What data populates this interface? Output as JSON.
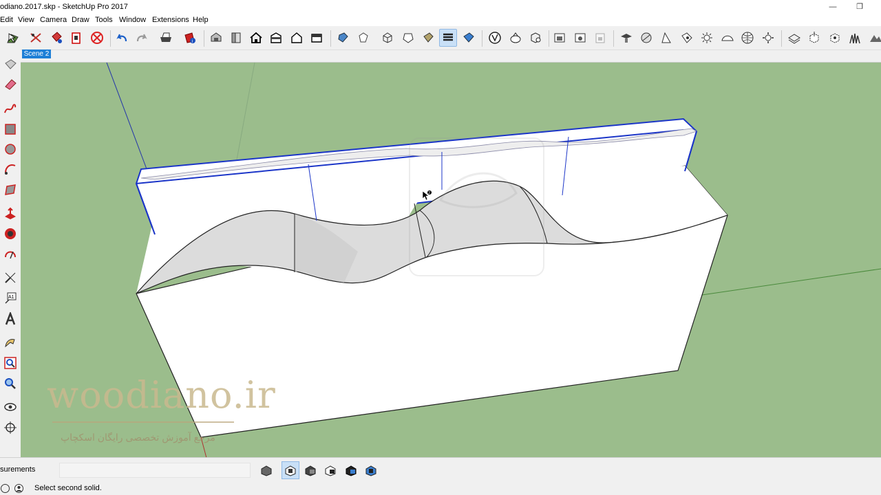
{
  "window": {
    "title": "odiano.2017.skp - SketchUp Pro 2017",
    "minimize": "—",
    "restore": "❐"
  },
  "menu": [
    "Edit",
    "View",
    "Camera",
    "Draw",
    "Tools",
    "Window",
    "Extensions",
    "Help"
  ],
  "toolbar_icons": [
    "select-icon",
    "eraser-icon",
    "paint-bucket-icon",
    "components-icon",
    "no-entry-icon",
    "undo-icon",
    "redo-icon",
    "print-icon",
    "model-info-icon",
    "iso-view-icon",
    "top-view-icon",
    "front-view-icon",
    "right-view-icon",
    "back-view-icon",
    "left-view-icon",
    "xray-icon",
    "back-edges-icon",
    "wireframe-icon",
    "hidden-line-icon",
    "shaded-icon",
    "shaded-textures-icon",
    "monochrome-icon",
    "outer-shell-icon",
    "intersect-icon",
    "union-icon",
    "camera-icon",
    "walk-icon",
    "lock-icon",
    "section-plane-icon",
    "display-section-icon",
    "display-cuts-icon",
    "shadows-icon",
    "fog-icon",
    "styles-icon",
    "geo-location-icon",
    "sandbox-icon",
    "stamp-icon",
    "drape-icon",
    "grass-icon",
    "extensions-icon"
  ],
  "scene_tab": "Scene 2",
  "left_tools": [
    "select-tool-icon",
    "eraser-tool-icon",
    "freehand-tool-icon",
    "rectangle-tool-icon",
    "circle-tool-icon",
    "arc-tool-icon",
    "polygon-tool-icon",
    "push-pull-tool-icon",
    "follow-me-tool-icon",
    "rotate-tool-icon",
    "tape-tool-icon",
    "text-tool-icon",
    "3d-text-tool-icon",
    "orbit-tool-icon",
    "zoom-tool-icon",
    "zoom-window-tool-icon",
    "look-around-tool-icon",
    "position-camera-tool-icon"
  ],
  "watermark": {
    "site": "woodiano.ir",
    "tagline": "مرجع آموزش تخصصی رایگان اسکچاپ"
  },
  "measurements": {
    "label": "surements",
    "value": ""
  },
  "solid_tools": [
    "outer-shell-icon",
    "intersect-icon",
    "union-icon",
    "subtract-icon",
    "trim-icon",
    "split-icon"
  ],
  "solid_tools_selected": "intersect-icon",
  "status": {
    "text": "Select second solid."
  },
  "colors": {
    "sky_ground": "#9bbd8c",
    "selection": "#1b35c8",
    "scene_tab": "#1e7fd6"
  }
}
